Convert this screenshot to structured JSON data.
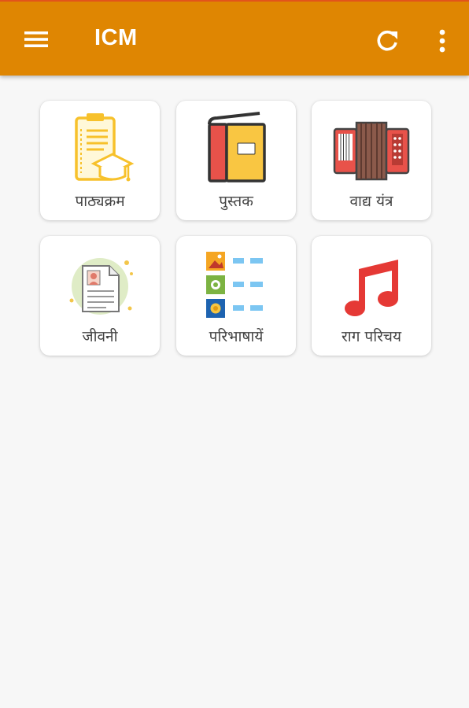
{
  "app_bar": {
    "title": "ICM",
    "menu_icon": "hamburger-menu-icon",
    "refresh_icon": "refresh-icon",
    "overflow_icon": "more-vertical-icon",
    "color": "#df8602"
  },
  "grid": {
    "items": [
      {
        "label": "पाठ्यक्रम",
        "icon": "syllabus-clipboard-icon"
      },
      {
        "label": "पुस्तक",
        "icon": "book-icon"
      },
      {
        "label": "वाद्य यंत्र",
        "icon": "accordion-icon"
      },
      {
        "label": "जीवनी",
        "icon": "biography-document-icon"
      },
      {
        "label": "परिभाषायें",
        "icon": "definitions-list-icon"
      },
      {
        "label": "राग परिचय",
        "icon": "music-note-icon"
      }
    ]
  }
}
